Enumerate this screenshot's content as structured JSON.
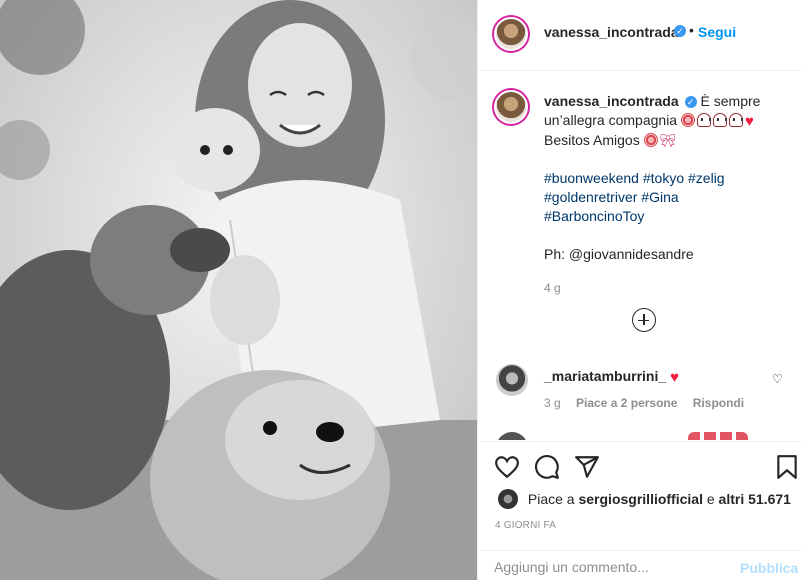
{
  "post": {
    "username": "vanessa_incontrada",
    "follow_label": "Segui",
    "dot": "•"
  },
  "caption": {
    "username": "vanessa_incontrada",
    "text_line1": "È sempre un’allegra compagnia",
    "text_line2": "Besitos Amigos",
    "hashtags": [
      "#buonweekend",
      "#tokyo",
      "#zelig",
      "#goldenretriver",
      "#Gina",
      "#BarboncinoToy"
    ],
    "photo_credit": "Ph: @giovannidesandre",
    "time": "4 g"
  },
  "comment": {
    "username": "_mariatamburrini_",
    "time": "3 g",
    "likes": "Piace a 2 persone",
    "reply": "Rispondi"
  },
  "likes": {
    "prefix": "Piace a",
    "user": "sergiosgrilliofficial",
    "mid": "e",
    "others": "altri 51.671"
  },
  "date": "4 GIORNI FA",
  "add_comment": {
    "placeholder": "Aggiungi un commento...",
    "publish": "Pubblica"
  },
  "icons": {
    "like": "heart-icon",
    "comment": "comment-icon",
    "share": "share-icon",
    "save": "bookmark-icon",
    "load_more": "plus-circle-icon"
  },
  "colors": {
    "accent": "#0095f6",
    "verified": "#3897f0",
    "text": "#262626",
    "muted": "#8e8e8e",
    "heart": "#ed1c3c"
  }
}
